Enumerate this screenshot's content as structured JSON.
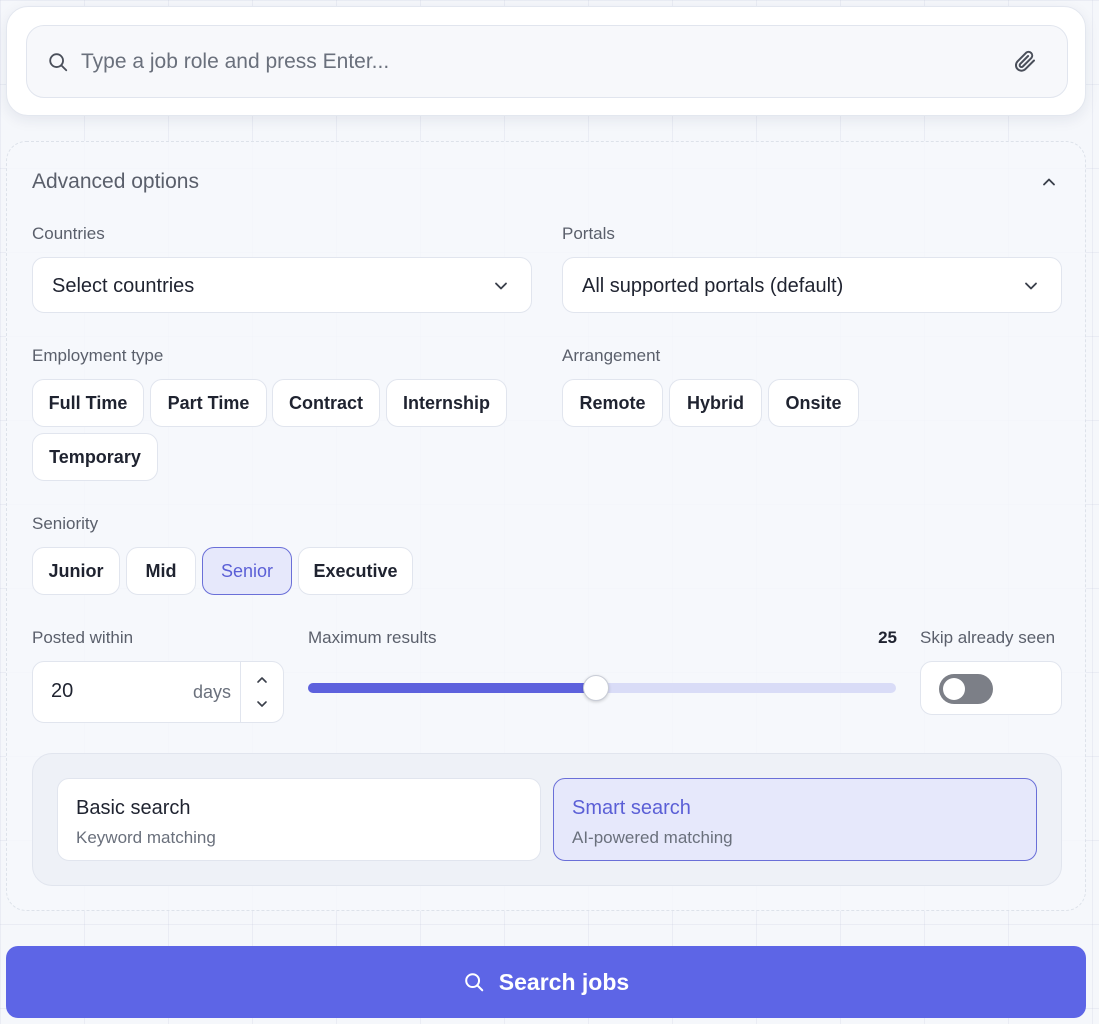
{
  "search": {
    "placeholder": "Type a job role and press Enter..."
  },
  "advanced": {
    "title": "Advanced options",
    "countries": {
      "label": "Countries",
      "value": "Select countries"
    },
    "portals": {
      "label": "Portals",
      "value": "All supported portals (default)"
    },
    "employment": {
      "label": "Employment type",
      "options": [
        "Full Time",
        "Part Time",
        "Contract",
        "Internship",
        "Temporary"
      ]
    },
    "arrangement": {
      "label": "Arrangement",
      "options": [
        "Remote",
        "Hybrid",
        "Onsite"
      ]
    },
    "seniority": {
      "label": "Seniority",
      "options": [
        "Junior",
        "Mid",
        "Senior",
        "Executive"
      ],
      "selected": "Senior"
    },
    "posted": {
      "label": "Posted within",
      "value": "20",
      "unit": "days"
    },
    "max_results": {
      "label": "Maximum results",
      "value": "25",
      "fraction": 0.49
    },
    "skip_seen": {
      "label": "Skip already seen",
      "on": false
    },
    "modes": [
      {
        "title": "Basic search",
        "subtitle": "Keyword matching",
        "active": false
      },
      {
        "title": "Smart search",
        "subtitle": "AI-powered matching",
        "active": true
      }
    ]
  },
  "search_button": {
    "label": "Search jobs"
  },
  "colors": {
    "accent": "#5d65e6",
    "active_chip_bg": "#e6e8fb",
    "active_text": "#5b5fd6"
  }
}
